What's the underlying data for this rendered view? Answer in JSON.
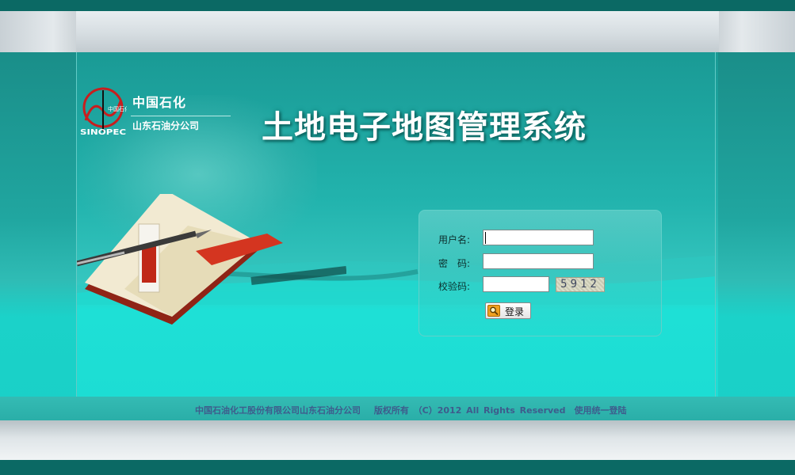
{
  "logo": {
    "emblem_text": "中国石化",
    "brand_latin": "SINOPEC",
    "company_cn": "中国石化",
    "branch_cn": "山东石油分公司",
    "emblem_color": "#d42020"
  },
  "title": "土地电子地图管理系统",
  "login": {
    "username_label": "用户名:",
    "username_value": "",
    "password_label": "密　码:",
    "password_value": "",
    "captcha_label": "校验码:",
    "captcha_value": "",
    "captcha_code": "5912",
    "submit_label": "登录",
    "submit_icon": "search-icon"
  },
  "footer": {
    "text": "中国石油化工股份有限公司山东石油分公司　 版权所有 （C）2012 All Rights Reserved　使用统一登陆"
  },
  "colors": {
    "teal_dark": "#0b6964",
    "teal": "#22b3ad",
    "teal_bright": "#1ee0d6",
    "footer_text": "#3e5c8c"
  }
}
